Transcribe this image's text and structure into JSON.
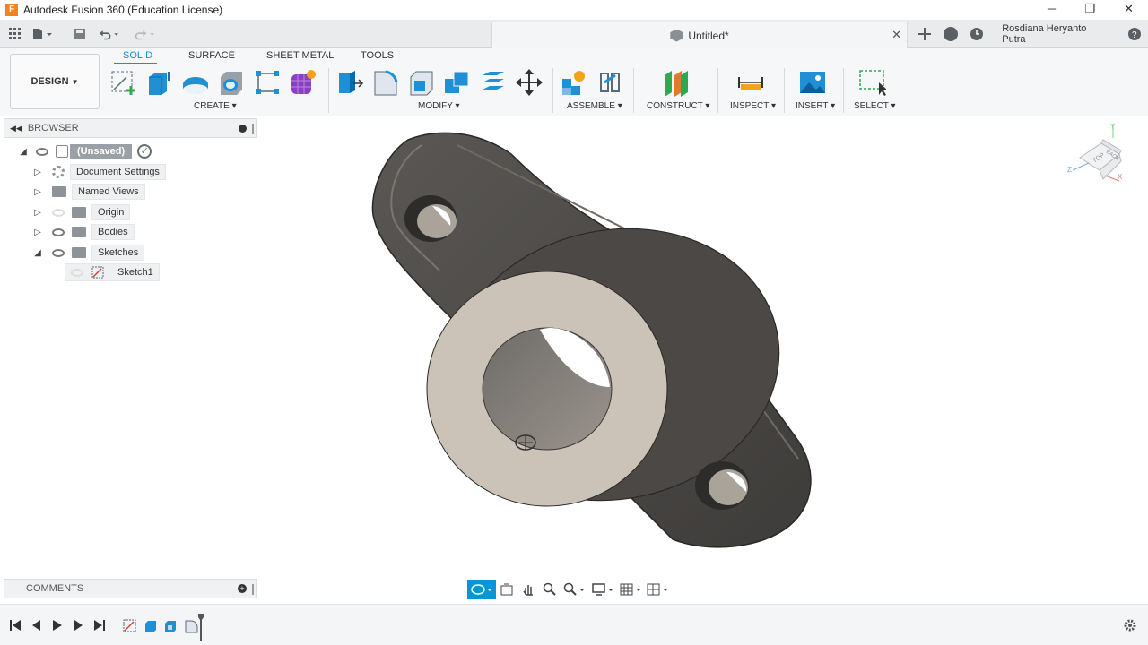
{
  "window": {
    "title": "Autodesk Fusion 360 (Education License)",
    "minimize": "─",
    "restore": "❐",
    "close": "✕"
  },
  "document_tab": {
    "title": "Untitled*",
    "close": "✕"
  },
  "user": {
    "name": "Rosdiana Heryanto Putra"
  },
  "ribbon": {
    "workspace": "DESIGN",
    "tabs": [
      "SOLID",
      "SURFACE",
      "SHEET METAL",
      "TOOLS"
    ],
    "groups": [
      "CREATE",
      "MODIFY",
      "ASSEMBLE",
      "CONSTRUCT",
      "INSPECT",
      "INSERT",
      "SELECT"
    ]
  },
  "browser": {
    "title": "BROWSER",
    "root": "(Unsaved)",
    "items": [
      "Document Settings",
      "Named Views",
      "Origin",
      "Bodies",
      "Sketches"
    ],
    "sketch": "Sketch1"
  },
  "comments": {
    "title": "COMMENTS"
  },
  "viewcube": {
    "faces": [
      "BACK",
      "TOP"
    ],
    "axes": [
      "Y",
      "Z",
      "X"
    ]
  },
  "colors": {
    "accent": "#0696d7",
    "body_dark": "#4a4744",
    "face_light": "#cbc3b8"
  }
}
